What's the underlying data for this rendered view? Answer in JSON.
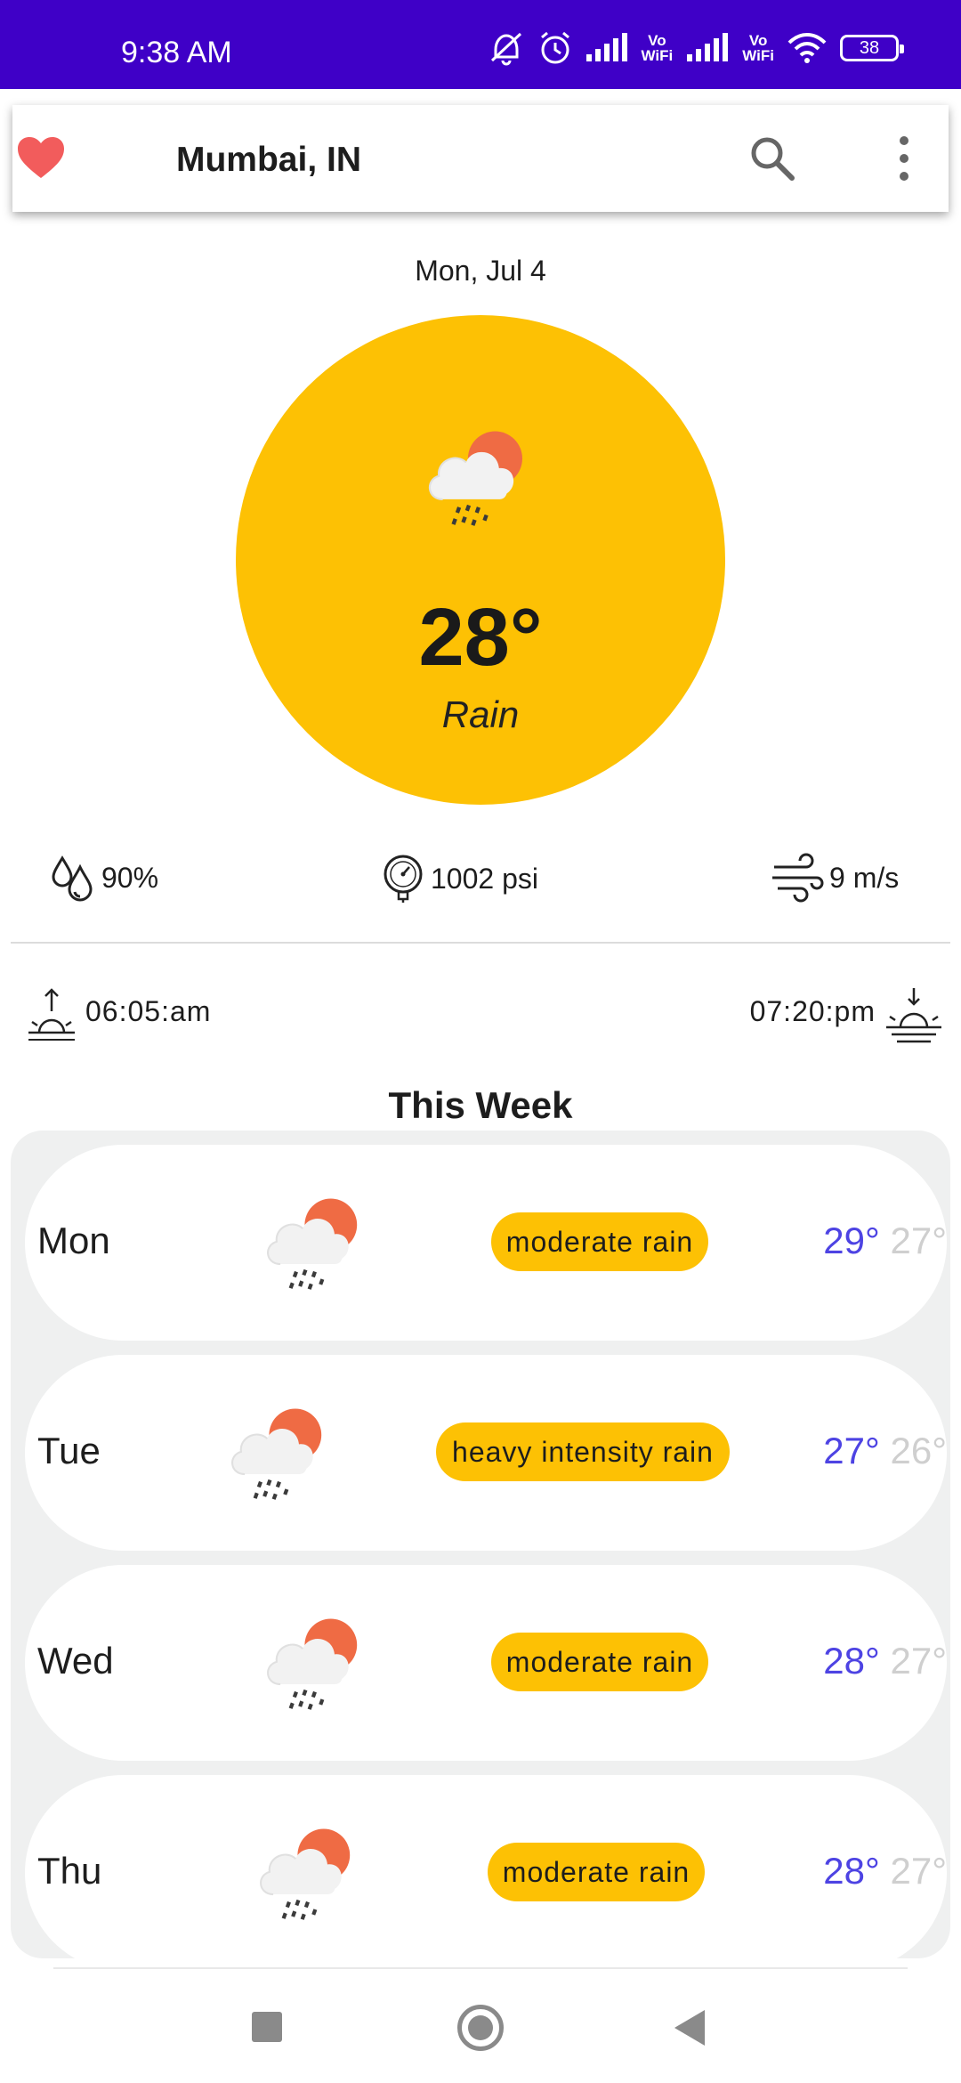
{
  "status_bar": {
    "time": "9:38 AM",
    "battery": "38",
    "vowifi_labels": [
      "Vo\nWiFi",
      "Vo\nWiFi"
    ],
    "icons": [
      "mute-icon",
      "alarm-icon",
      "signal-icon",
      "signal-icon",
      "wifi-icon",
      "battery-icon"
    ]
  },
  "app_bar": {
    "city": "Mumbai, IN",
    "icons": [
      "heart-icon",
      "search-icon",
      "more-vert-icon"
    ]
  },
  "current": {
    "date": "Mon, Jul 4",
    "temperature": "28°",
    "condition": "Rain",
    "icon": "rain-cloud-sun-icon",
    "humidity": "90%",
    "pressure": "1002 psi",
    "wind": "9 m/s",
    "sunrise": "06:05:am",
    "sunset": "07:20:pm"
  },
  "week": {
    "title": "This Week",
    "days": [
      {
        "day": "Mon",
        "description": "moderate rain",
        "high": "29°",
        "low": "27°"
      },
      {
        "day": "Tue",
        "description": "heavy intensity rain",
        "high": "27°",
        "low": "26°"
      },
      {
        "day": "Wed",
        "description": "moderate rain",
        "high": "28°",
        "low": "27°"
      },
      {
        "day": "Thu",
        "description": "moderate rain",
        "high": "28°",
        "low": "27°"
      }
    ]
  },
  "colors": {
    "status_bar": "#3f00c7",
    "accent_yellow": "#fdc104",
    "high_temp": "#4d43e3",
    "low_temp": "#cfcfcf",
    "heart": "#f25c5c"
  }
}
